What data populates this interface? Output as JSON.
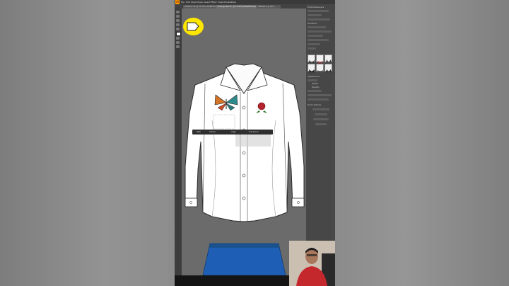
{
  "app": {
    "name": "Adobe Illustrator",
    "logo_text": "Ai",
    "menus": [
      "File",
      "Edit",
      "Object",
      "Type",
      "Select",
      "Effect",
      "View",
      "Window",
      "Help"
    ],
    "tabs": [
      {
        "label": "Untitled-1.ai @ 51.95% (RGB/Preview)",
        "active": false
      },
      {
        "label": "clothing-shirt.ai* @ 53.58% (RGB/Preview)",
        "active": true
      },
      {
        "label": "Untitled-2 @ 25%",
        "active": false
      }
    ]
  },
  "context_toolbar": {
    "items": [
      "Path",
      "Stroke",
      "Align",
      "Transform"
    ]
  },
  "properties_panel": {
    "sections": [
      "Properties",
      "Layers",
      "Libraries"
    ],
    "transform_label": "Transform",
    "appearance_label": "Appearance",
    "stroke_label": "Stroke",
    "opacity_label": "Opacity",
    "quick_actions_label": "Quick Actions",
    "buttons": [
      "Offset Path",
      "Recolor",
      "Start Global Edit"
    ]
  },
  "symbols_panel": {
    "swatch_count": 6,
    "items": [
      "butterfly-1",
      "butterfly-2",
      "butterfly-3",
      "butterfly-4",
      "butterfly-5",
      "butterfly-6"
    ]
  },
  "artwork": {
    "garments": [
      "shirt-long-sleeve",
      "skirt-blue"
    ],
    "shirt_color": "#ffffff",
    "skirt_color": "#1e5fb5"
  },
  "colors": {
    "callout": "#ffe600",
    "app_bg": "#535353",
    "panel_bg": "#474747"
  }
}
